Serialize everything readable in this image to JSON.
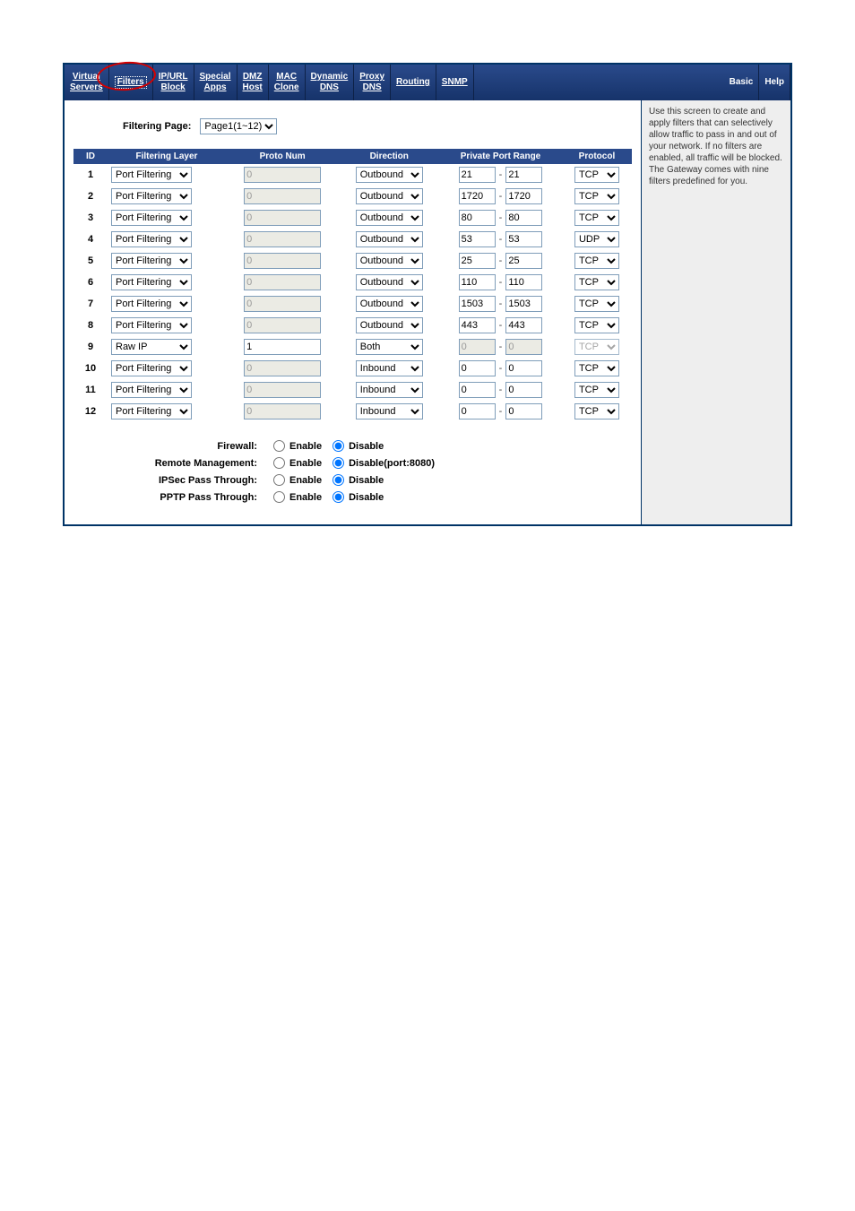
{
  "tabs": {
    "virtual_servers": "Virtual\nServers",
    "filters": "Filters",
    "ipurl_block": "IP/URL\nBlock",
    "special_apps": "Special\nApps",
    "dmz_host": "DMZ\nHost",
    "mac_clone": "MAC\nClone",
    "dynamic_dns": "Dynamic\nDNS",
    "proxy_dns": "Proxy\nDNS",
    "routing": "Routing",
    "snmp": "SNMP",
    "basic": "Basic",
    "help": "Help"
  },
  "labels": {
    "filtering_page": "Filtering Page:",
    "page_option": "Page1(1~12)",
    "headers": {
      "id": "ID",
      "layer": "Filtering Layer",
      "proto_num": "Proto Num",
      "direction": "Direction",
      "port_range": "Private Port Range",
      "protocol": "Protocol"
    },
    "opt_firewall": "Firewall:",
    "opt_remote": "Remote Management:",
    "opt_ipsec": "IPSec Pass Through:",
    "opt_pptp": "PPTP Pass Through:",
    "enable": "Enable",
    "disable": "Disable",
    "disable_port": "Disable(port:8080)"
  },
  "side_text": "Use this screen to create and apply filters that can selectively allow traffic to pass in and out of your network. If no filters are enabled, all traffic will be blocked. The Gateway comes with nine filters predefined for you.",
  "layer_options": [
    "Port Filtering",
    "Raw IP"
  ],
  "direction_options": [
    "Outbound",
    "Inbound",
    "Both"
  ],
  "protocol_options": [
    "TCP",
    "UDP"
  ],
  "rows": [
    {
      "id": "1",
      "layer": "Port Filtering",
      "proto": "0",
      "proto_disabled": true,
      "dir": "Outbound",
      "p1": "21",
      "p2": "21",
      "proto_sel": "TCP",
      "port_disabled": false,
      "protocol_disabled": false
    },
    {
      "id": "2",
      "layer": "Port Filtering",
      "proto": "0",
      "proto_disabled": true,
      "dir": "Outbound",
      "p1": "1720",
      "p2": "1720",
      "proto_sel": "TCP",
      "port_disabled": false,
      "protocol_disabled": false
    },
    {
      "id": "3",
      "layer": "Port Filtering",
      "proto": "0",
      "proto_disabled": true,
      "dir": "Outbound",
      "p1": "80",
      "p2": "80",
      "proto_sel": "TCP",
      "port_disabled": false,
      "protocol_disabled": false
    },
    {
      "id": "4",
      "layer": "Port Filtering",
      "proto": "0",
      "proto_disabled": true,
      "dir": "Outbound",
      "p1": "53",
      "p2": "53",
      "proto_sel": "UDP",
      "port_disabled": false,
      "protocol_disabled": false
    },
    {
      "id": "5",
      "layer": "Port Filtering",
      "proto": "0",
      "proto_disabled": true,
      "dir": "Outbound",
      "p1": "25",
      "p2": "25",
      "proto_sel": "TCP",
      "port_disabled": false,
      "protocol_disabled": false
    },
    {
      "id": "6",
      "layer": "Port Filtering",
      "proto": "0",
      "proto_disabled": true,
      "dir": "Outbound",
      "p1": "110",
      "p2": "110",
      "proto_sel": "TCP",
      "port_disabled": false,
      "protocol_disabled": false
    },
    {
      "id": "7",
      "layer": "Port Filtering",
      "proto": "0",
      "proto_disabled": true,
      "dir": "Outbound",
      "p1": "1503",
      "p2": "1503",
      "proto_sel": "TCP",
      "port_disabled": false,
      "protocol_disabled": false
    },
    {
      "id": "8",
      "layer": "Port Filtering",
      "proto": "0",
      "proto_disabled": true,
      "dir": "Outbound",
      "p1": "443",
      "p2": "443",
      "proto_sel": "TCP",
      "port_disabled": false,
      "protocol_disabled": false
    },
    {
      "id": "9",
      "layer": "Raw IP",
      "proto": "1",
      "proto_disabled": false,
      "dir": "Both",
      "p1": "0",
      "p2": "0",
      "proto_sel": "TCP",
      "port_disabled": true,
      "protocol_disabled": true
    },
    {
      "id": "10",
      "layer": "Port Filtering",
      "proto": "0",
      "proto_disabled": true,
      "dir": "Inbound",
      "p1": "0",
      "p2": "0",
      "proto_sel": "TCP",
      "port_disabled": false,
      "protocol_disabled": false
    },
    {
      "id": "11",
      "layer": "Port Filtering",
      "proto": "0",
      "proto_disabled": true,
      "dir": "Inbound",
      "p1": "0",
      "p2": "0",
      "proto_sel": "TCP",
      "port_disabled": false,
      "protocol_disabled": false
    },
    {
      "id": "12",
      "layer": "Port Filtering",
      "proto": "0",
      "proto_disabled": true,
      "dir": "Inbound",
      "p1": "0",
      "p2": "0",
      "proto_sel": "TCP",
      "port_disabled": false,
      "protocol_disabled": false
    }
  ],
  "options": {
    "firewall": "disable",
    "remote": "disable",
    "ipsec": "disable",
    "pptp": "disable"
  }
}
